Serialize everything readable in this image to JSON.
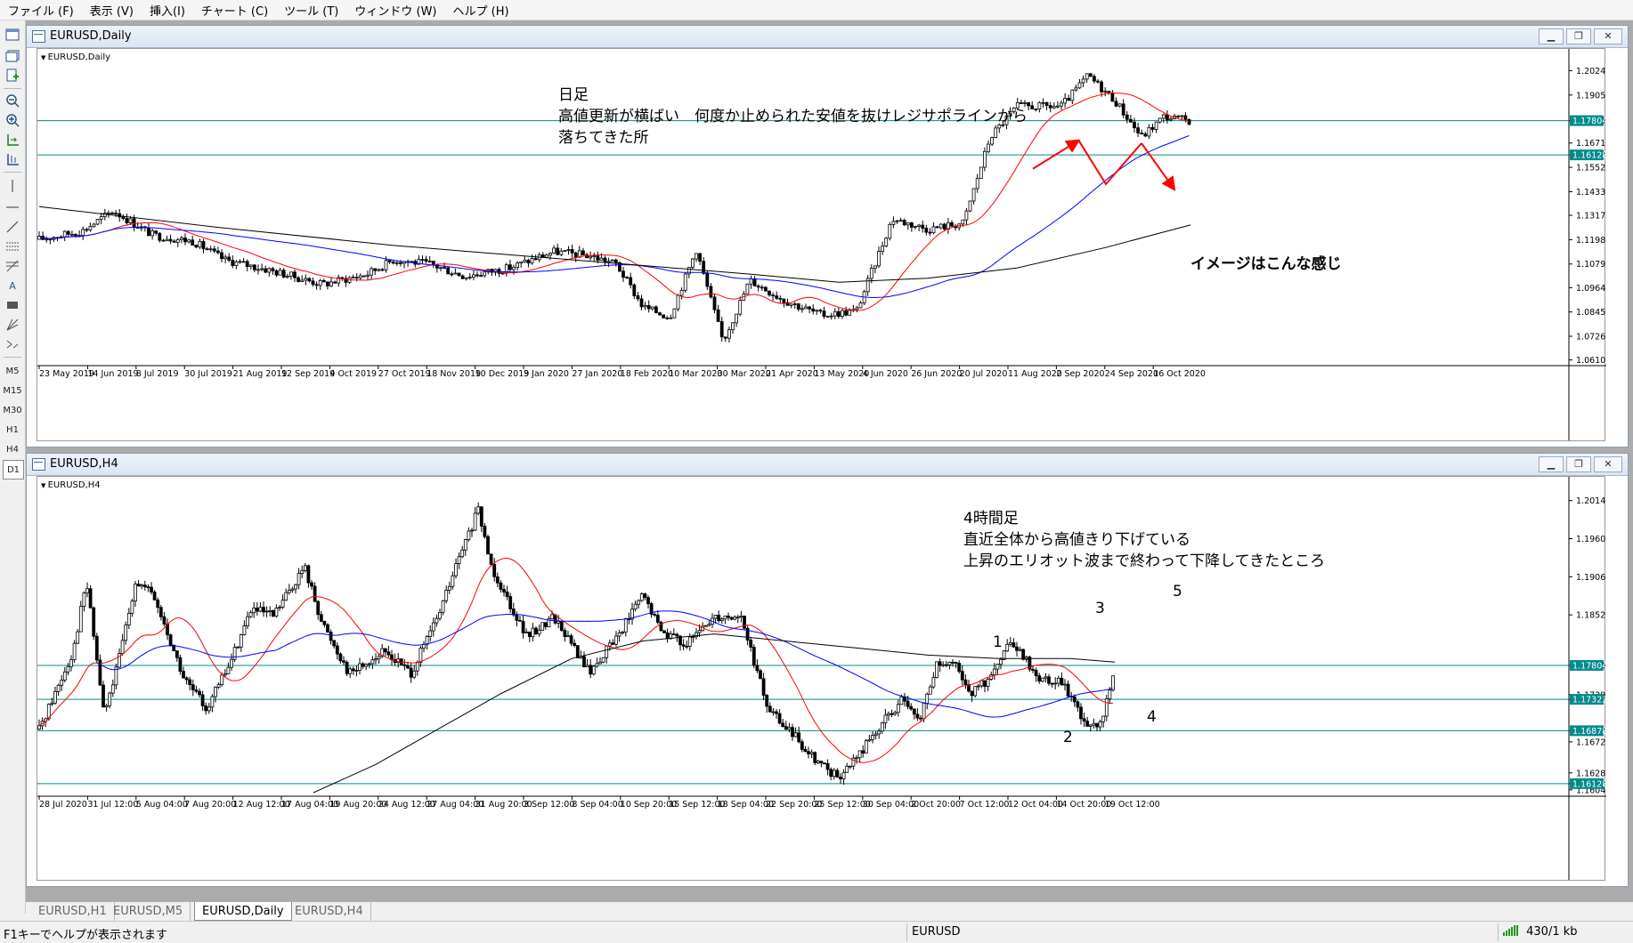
{
  "menu": [
    "ファイル (F)",
    "表示 (V)",
    "挿入(I)",
    "チャート (C)",
    "ツール (T)",
    "ウィンドウ (W)",
    "ヘルプ (H)"
  ],
  "toolbar": {
    "timeframes": [
      "M5",
      "M15",
      "M30",
      "H1",
      "H4",
      "D1"
    ],
    "text_tool": "A"
  },
  "colors": {
    "candle": "#000000",
    "ma_fast": "#ff0000",
    "ma_mid": "#0000ff",
    "ma_slow": "#000000",
    "hline": "#008b8b",
    "price_badge": "#008b8b",
    "annotation_arrow": "#ff0000"
  },
  "daily": {
    "window_title": "EURUSD,Daily",
    "plot_label": "EURUSD,Daily",
    "note": [
      "日足",
      "高値更新が横ばい　何度か止められた安値を抜けレジサポラインから",
      "落ちてきた所"
    ],
    "callout": "イメージはこんな感じ",
    "price_ticks": [
      "1.20245",
      "1.19055",
      "1.17804",
      "1.16710",
      "1.16128",
      "1.15520",
      "1.14330",
      "1.13175",
      "1.11985",
      "1.10795",
      "1.09640",
      "1.08450",
      "1.07260",
      "1.06105"
    ],
    "badges": [
      "1.17804",
      "1.16128"
    ],
    "dates": [
      "23 May 2019",
      "14 Jun 2019",
      "8 Jul 2019",
      "30 Jul 2019",
      "21 Aug 2019",
      "12 Sep 2019",
      "4 Oct 2019",
      "27 Oct 2019",
      "18 Nov 2019",
      "10 Dec 2019",
      "3 Jan 2020",
      "27 Jan 2020",
      "18 Feb 2020",
      "10 Mar 2020",
      "30 Mar 2020",
      "21 Apr 2020",
      "13 May 2020",
      "4 Jun 2020",
      "26 Jun 2020",
      "20 Jul 2020",
      "11 Aug 2020",
      "2 Sep 2020",
      "24 Sep 2020",
      "16 Oct 2020"
    ]
  },
  "h4": {
    "window_title": "EURUSD,H4",
    "plot_label": "EURUSD,H4",
    "note": [
      "4時間足",
      "直近全体から高値きり下げている",
      "上昇のエリオット波まで終わって下降してきたところ"
    ],
    "waves": [
      "1",
      "2",
      "3",
      "4",
      "5"
    ],
    "price_ticks": [
      "1.20140",
      "1.19600",
      "1.19060",
      "1.18520",
      "1.17804",
      "1.17390",
      "1.17323",
      "1.16878",
      "1.16720",
      "1.16280",
      "1.16128",
      "1.16040"
    ],
    "badges": [
      "1.17804",
      "1.17323",
      "1.16878",
      "1.16128"
    ],
    "dates": [
      "28 Jul 2020",
      "31 Jul 12:00",
      "5 Aug 04:00",
      "7 Aug 20:00",
      "12 Aug 12:00",
      "17 Aug 04:00",
      "19 Aug 20:00",
      "24 Aug 12:00",
      "27 Aug 04:00",
      "31 Aug 20:00",
      "3 Sep 12:00",
      "8 Sep 04:00",
      "10 Sep 20:00",
      "15 Sep 12:00",
      "18 Sep 04:00",
      "22 Sep 20:00",
      "25 Sep 12:00",
      "30 Sep 04:00",
      "2 Oct 20:00",
      "7 Oct 12:00",
      "12 Oct 04:00",
      "14 Oct 20:00",
      "19 Oct 12:00"
    ]
  },
  "tabs": [
    "EURUSD,H1",
    "EURUSD,M5",
    "EURUSD,Daily",
    "EURUSD,H4"
  ],
  "active_tab": "EURUSD,Daily",
  "status": {
    "help": "F1キーでヘルプが表示されます",
    "symbol": "EURUSD",
    "traffic": "430/1 kb"
  }
}
